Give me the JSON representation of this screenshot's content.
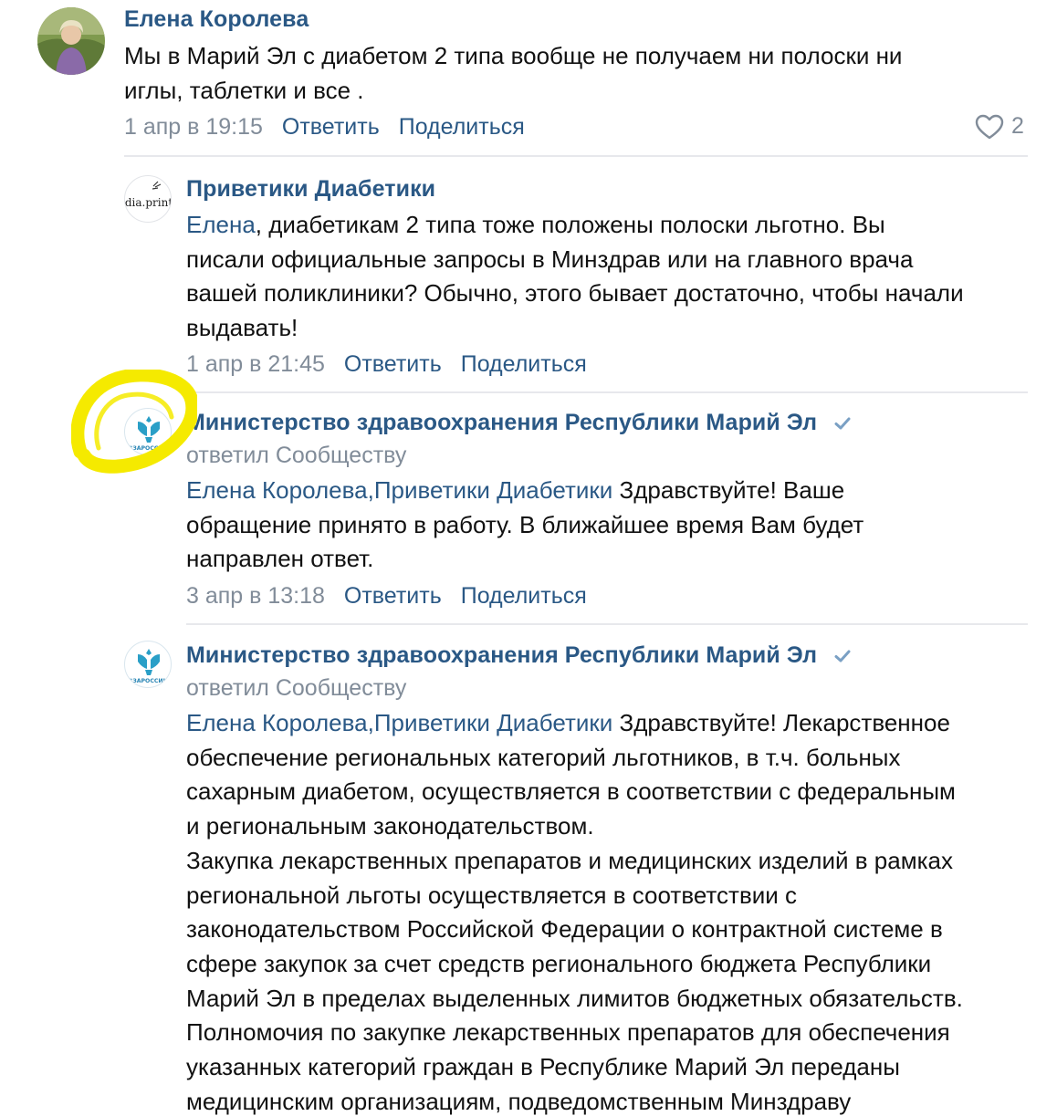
{
  "comments": [
    {
      "author": "Елена Королева",
      "lines": [
        "Мы в Марий Эл с диабетом 2 типа вообще не получаем ни полоски ни",
        "иглы, таблетки и все ."
      ],
      "date": "1 апр в 19:15",
      "reply_label": "Ответить",
      "share_label": "Поделиться",
      "likes": "2",
      "avatar_icon": "user-photo"
    },
    {
      "author": "Приветики Диабетики",
      "avatar_text": "dia.print",
      "mention": "Елена",
      "lines": [
        ", диабетикам 2 типа тоже положены полоски льготно. Вы",
        "писали официальные запросы в Минздрав или на главного врача",
        "вашей поликлиники? Обычно, этого бывает достаточно, чтобы начали",
        "выдавать!"
      ],
      "date": "1 апр в 21:45",
      "reply_label": "Ответить",
      "share_label": "Поделиться"
    },
    {
      "author": "Министерство здравоохранения Республики Марий Эл",
      "subline": "ответил Сообществу",
      "avatar_text": "#ЗАРОССИЮ",
      "mention1": "Елена Королева",
      "mention_sep": ",",
      "mention2": "Приветики Диабетики",
      "lines": [
        " Здравствуйте! Ваше",
        "обращение принято в работу. В ближайшее время Вам будет",
        "направлен ответ."
      ],
      "date": "3 апр в 13:18",
      "reply_label": "Ответить",
      "share_label": "Поделиться"
    },
    {
      "author": "Министерство здравоохранения Республики Марий Эл",
      "subline": "ответил Сообществу",
      "avatar_text": "#ЗАРОССИЮ",
      "mention1": "Елена Королева",
      "mention_sep": ",",
      "mention2": "Приветики Диабетики",
      "lines": [
        " Здравствуйте! Лекарственное",
        "обеспечение региональных категорий льготников, в т.ч. больных",
        "сахарным диабетом, осуществляется в соответствии с федеральным",
        "и региональным законодательством.",
        "Закупка лекарственных препаратов и медицинских изделий в рамках",
        "региональной льготы осуществляется в соответствии с",
        "законодательством Российской Федерации о контрактной системе в",
        "сфере закупок за счет средств регионального бюджета Республики",
        "Марий Эл в пределах выделенных лимитов бюджетных обязательств.",
        "Полномочия по закупке лекарственных препаратов для обеспечения",
        "указанных категорий граждан в Республике Марий Эл переданы",
        "медицинским организациям, подведомственным Минздраву"
      ]
    }
  ],
  "colors": {
    "link": "#2a5885",
    "secondary": "#818c99",
    "text": "#111111",
    "divider": "#e7e8ec",
    "highlight": "#f5ea00"
  }
}
